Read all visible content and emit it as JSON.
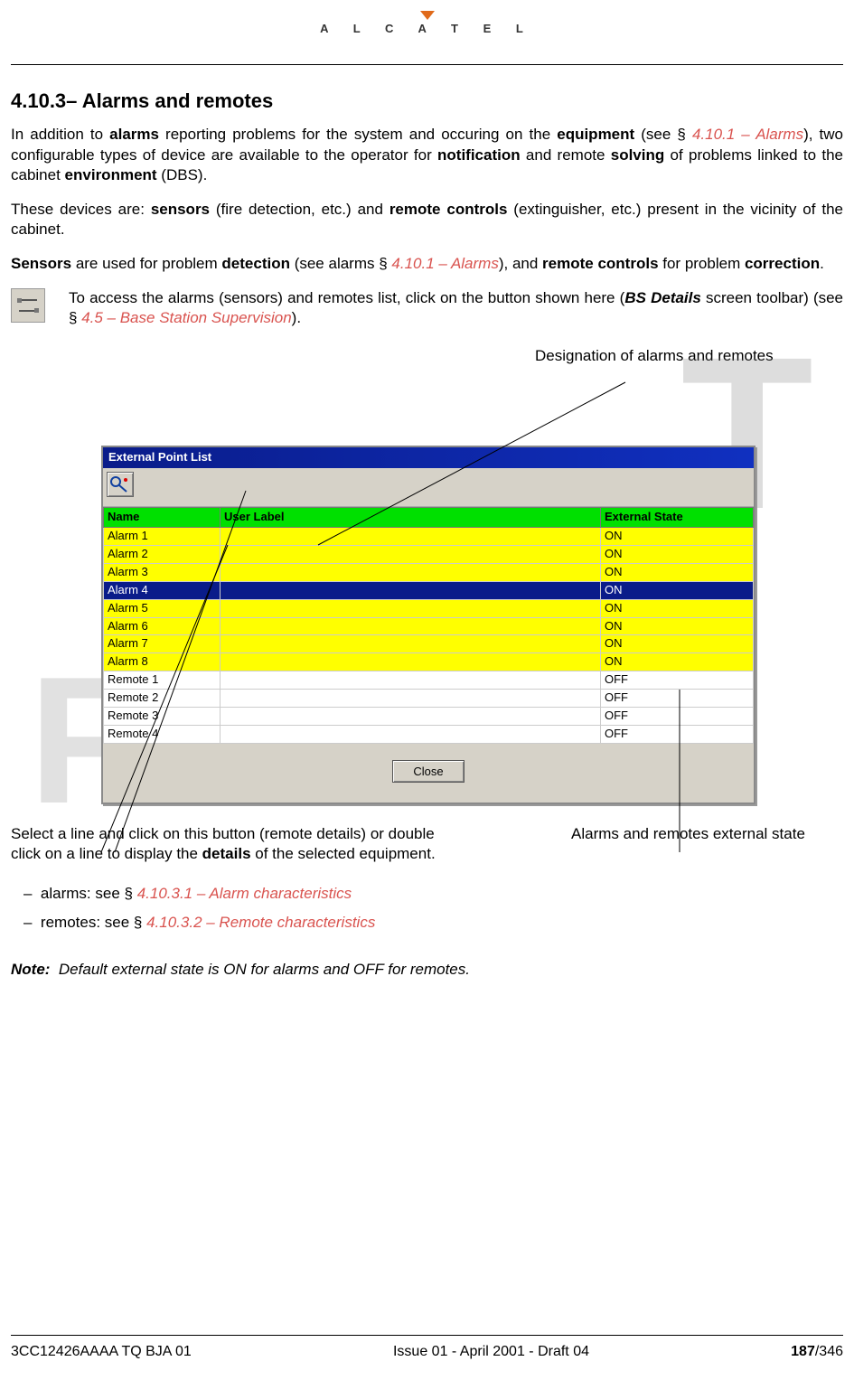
{
  "logo_text": "A L C A T E L",
  "section_title": "4.10.3– Alarms and remotes",
  "p1_a": "In addition to ",
  "p1_b": "alarms",
  "p1_c": " reporting problems for the system and occuring on the ",
  "p1_d": "equipment",
  "p1_e": " (see § ",
  "p1_ref": "4.10.1 – Alarms",
  "p1_f": "), two configurable types of device are available to the operator for ",
  "p1_g": "notification",
  "p1_h": " and remote ",
  "p1_i": "solving",
  "p1_j": " of problems linked to the cabinet ",
  "p1_k": "environment",
  "p1_l": " (DBS).",
  "p2_a": "These devices are: ",
  "p2_b": "sensors",
  "p2_c": " (fire detection, etc.) and ",
  "p2_d": "remote controls",
  "p2_e": " (extinguisher, etc.) present in the vicinity of the cabinet.",
  "p3_a": "Sensors",
  "p3_b": " are used for problem ",
  "p3_c": "detection",
  "p3_d": " (see alarms § ",
  "p3_ref": "4.10.1 – Alarms",
  "p3_e": "), and ",
  "p3_f": "remote controls",
  "p3_g": " for problem ",
  "p3_h": "correction",
  "p3_i": ".",
  "icon_para_a": "To access the alarms (sensors) and remotes list, click on the button shown here (",
  "icon_para_b": "BS Details",
  "icon_para_c": " screen toolbar) (see § ",
  "icon_para_ref": "4.5 – Base Station Supervision",
  "icon_para_d": ").",
  "annot_top": "Designation of alarms and remotes",
  "window_title": "External Point List",
  "headers": {
    "name": "Name",
    "user_label": "User Label",
    "state": "External State"
  },
  "rows": [
    {
      "name": "Alarm 1",
      "label": "",
      "state": "ON",
      "cls": "yellow"
    },
    {
      "name": "Alarm 2",
      "label": "",
      "state": "ON",
      "cls": "yellow"
    },
    {
      "name": "Alarm 3",
      "label": "",
      "state": "ON",
      "cls": "yellow"
    },
    {
      "name": "Alarm 4",
      "label": "",
      "state": "ON",
      "cls": "selected"
    },
    {
      "name": "Alarm 5",
      "label": "",
      "state": "ON",
      "cls": "yellow"
    },
    {
      "name": "Alarm 6",
      "label": "",
      "state": "ON",
      "cls": "yellow"
    },
    {
      "name": "Alarm 7",
      "label": "",
      "state": "ON",
      "cls": "yellow"
    },
    {
      "name": "Alarm 8",
      "label": "",
      "state": "ON",
      "cls": "yellow"
    },
    {
      "name": "Remote 1",
      "label": "",
      "state": "OFF",
      "cls": ""
    },
    {
      "name": "Remote 2",
      "label": "",
      "state": "OFF",
      "cls": ""
    },
    {
      "name": "Remote 3",
      "label": "",
      "state": "OFF",
      "cls": ""
    },
    {
      "name": "Remote 4",
      "label": "",
      "state": "OFF",
      "cls": ""
    }
  ],
  "close_label": "Close",
  "callout_left_a": "Select a line and click on this button (remote details) or double click on a line to display the ",
  "callout_left_b": "details",
  "callout_left_c": " of the selected equipment.",
  "callout_right": "Alarms and remotes external state",
  "bullet_dash": "–",
  "bullet1_a": "alarms: see § ",
  "bullet1_ref": "4.10.3.1 – Alarm characteristics",
  "bullet2_a": "remotes: see § ",
  "bullet2_ref": "4.10.3.2 – Remote characteristics",
  "note_label": "Note:",
  "note_text": "Default external state is ON for alarms and OFF for remotes.",
  "footer_left": "3CC12426AAAA TQ BJA 01",
  "footer_center": "Issue 01 - April 2001 - Draft 04",
  "footer_page_bold": "187",
  "footer_page_rest": "/346"
}
